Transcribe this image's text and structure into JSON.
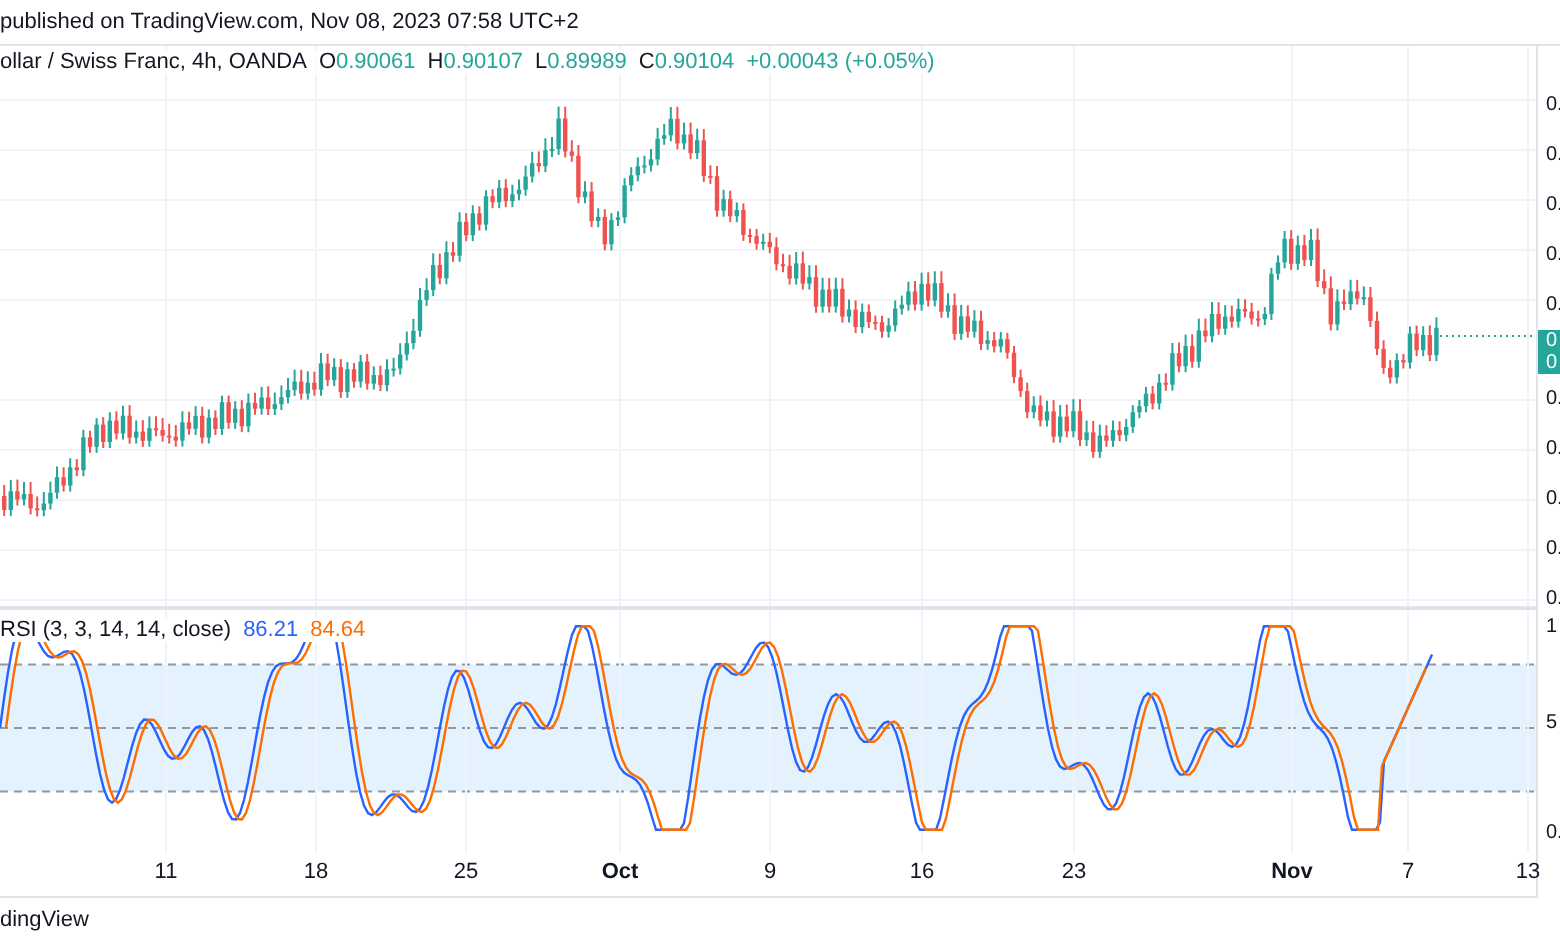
{
  "header": {
    "published": "published on TradingView.com, Nov 08, 2023 07:58 UTC+2"
  },
  "legend": {
    "symbol": "ollar / Swiss Franc, 4h, OANDA",
    "ohlc": [
      {
        "label": "O",
        "value": "0.90061"
      },
      {
        "label": "H",
        "value": "0.90107"
      },
      {
        "label": "L",
        "value": "0.89989"
      },
      {
        "label": "C",
        "value": "0.90104"
      }
    ],
    "change": "+0.00043 (+0.05%)"
  },
  "price_axis": {
    "labels_above": [
      "0.",
      "0.",
      "0.",
      "0.",
      "0."
    ],
    "current_price": [
      "0",
      "0"
    ],
    "labels_below": [
      "0.",
      "0.",
      "0.",
      "0.",
      "0."
    ]
  },
  "indicator": {
    "name": "RSI (3, 3, 14, 14, close)",
    "values": [
      {
        "value": "86.21",
        "color": "#2962ff"
      },
      {
        "value": "84.64",
        "color": "#ff6d00"
      }
    ],
    "axis_labels": [
      "1",
      "5",
      "0."
    ]
  },
  "date_axis": [
    {
      "label": "11",
      "bold": false
    },
    {
      "label": "18",
      "bold": false
    },
    {
      "label": "25",
      "bold": false
    },
    {
      "label": "Oct",
      "bold": true
    },
    {
      "label": "9",
      "bold": false
    },
    {
      "label": "16",
      "bold": false
    },
    {
      "label": "23",
      "bold": false
    },
    {
      "label": "Nov",
      "bold": true
    },
    {
      "label": "7",
      "bold": false
    },
    {
      "label": "13",
      "bold": false
    }
  ],
  "footer": {
    "brand": "dingView"
  }
}
